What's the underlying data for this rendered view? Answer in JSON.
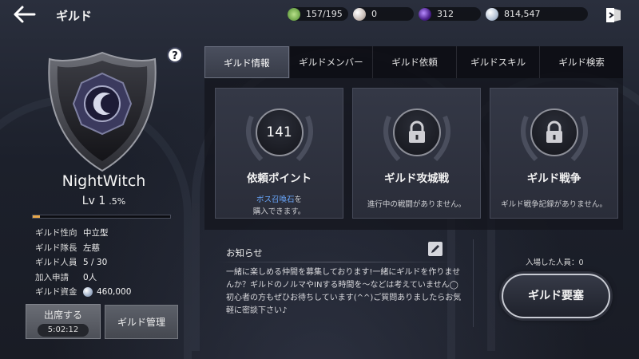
{
  "header": {
    "title": "ギルド",
    "resources": [
      {
        "icon": "stamina-icon",
        "value": "157/195",
        "color": "#6fae4a"
      },
      {
        "icon": "pearl-icon",
        "value": "0",
        "color": "#d8d0cc"
      },
      {
        "icon": "dark-orb-icon",
        "value": "312",
        "color": "#6a3fb5"
      },
      {
        "icon": "silver-coin-icon",
        "value": "814,547",
        "color": "#aab8cc"
      }
    ]
  },
  "guild": {
    "name": "NightWitch",
    "level": "Lv 1",
    "exp_percent": ".5%",
    "exp_fill": 0.05,
    "stats": [
      {
        "label": "ギルド性向",
        "value": "中立型"
      },
      {
        "label": "ギルド隊長",
        "value": "左慈"
      },
      {
        "label": "ギルド人員",
        "value": "5 / 30"
      },
      {
        "label": "加入申請",
        "value": "0人"
      },
      {
        "label": "ギルド資金",
        "value": "460,000"
      }
    ],
    "sortie_label": "出席する",
    "sortie_timer": "5:02:12",
    "manage_label": "ギルド管理"
  },
  "tabs": [
    "ギルド情報",
    "ギルドメンバー",
    "ギルド依頼",
    "ギルドスキル",
    "ギルド検索"
  ],
  "cards": [
    {
      "center": "141",
      "title": "依頼ポイント",
      "desc_highlight": "ボス召喚石",
      "desc_after": "を",
      "desc_line2": "購入できます。"
    },
    {
      "center": "lock",
      "title": "ギルド攻城戦",
      "desc": "進行中の戦闘がありません。"
    },
    {
      "center": "lock",
      "title": "ギルド戦争",
      "desc": "ギルド戦争記録がありません。"
    }
  ],
  "notice": {
    "title": "お知らせ",
    "body": "一緒に楽しめる仲間を募集しております!一緒にギルドを作りませんか？ギルドのノルマやINする時間を〜などは考えていません◯初心者の方もぜひお待ちしています(^^)ご質問ありましたらお気軽に密談下さい♪"
  },
  "fortress": {
    "entered_label": "入場した人員：0",
    "button_label": "ギルド要塞"
  }
}
